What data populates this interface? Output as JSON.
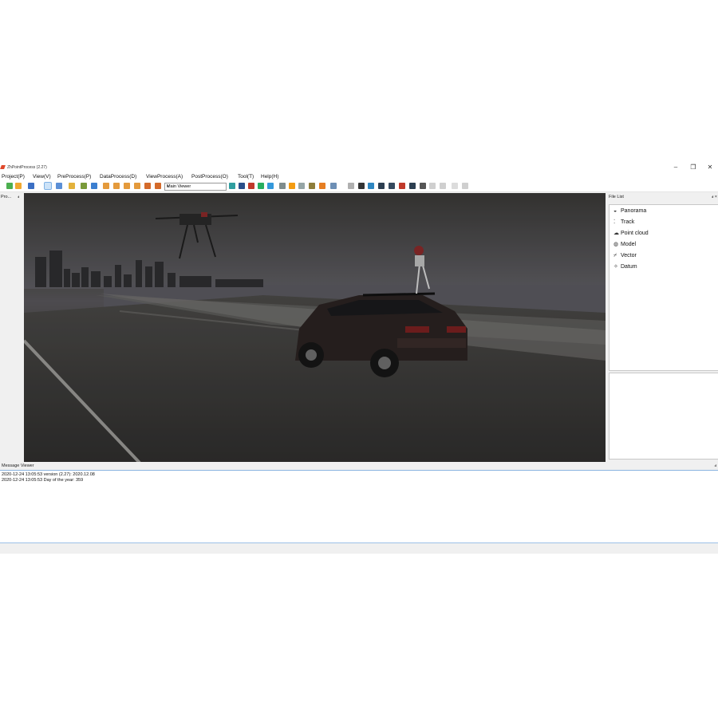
{
  "window": {
    "title": "ZhPointProcess (2.27)",
    "controls": {
      "minimize": "–",
      "maximize": "❐",
      "close": "✕"
    }
  },
  "menu": [
    "Project(P)",
    "View(V)",
    "PreProcess(P)",
    "DataProcess(D)",
    "ViewProcess(A)",
    "PostProcess(O)",
    "Tool(T)",
    "Help(H)"
  ],
  "toolbar": {
    "viewer_select": {
      "value": "Main Viewer",
      "arrow": "▾"
    }
  },
  "left_panel": {
    "title": "Pro...",
    "pin": "ⅎ"
  },
  "right_panel": {
    "title": "File List",
    "buttons": "ⅎ ×",
    "items": [
      {
        "icon": "◒",
        "label": "Panorama"
      },
      {
        "icon": "⁚",
        "label": "Track"
      },
      {
        "icon": "☁",
        "label": "Point cloud"
      },
      {
        "icon": "◍",
        "label": "Model"
      },
      {
        "icon": "⌿",
        "label": "Vector"
      },
      {
        "icon": "✧",
        "label": "Datum"
      }
    ]
  },
  "message_viewer": {
    "title": "Message Viewer",
    "pin": "ⅎ",
    "lines": [
      "2020-12-24 13:05:53   version (2.27):  2020.12.08",
      "2020-12-24 13:05:53   Day of the year: 359"
    ]
  },
  "colors": {
    "accent": "#7fb2e5",
    "app_icon": "#e0482b"
  }
}
